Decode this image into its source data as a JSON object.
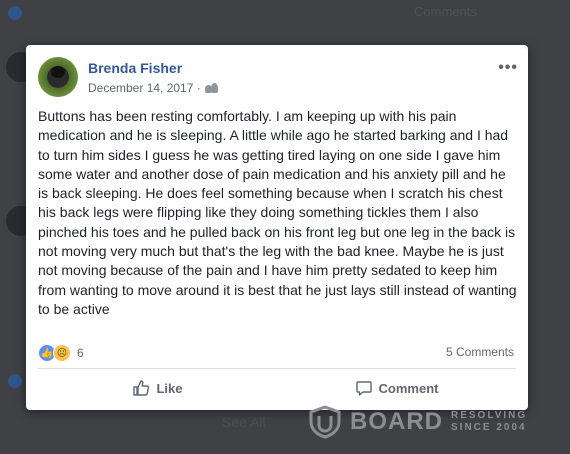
{
  "post": {
    "author": "Brenda Fisher",
    "date": "December 14, 2017 ·",
    "privacy_icon": "friends-icon",
    "more_label": "•••",
    "text": "Buttons has been resting comfortably. I am keeping up with his pain medication and he is sleeping. A little while ago he started barking and I had to turn him sides I guess he was getting tired laying on one side I gave him some water and another dose of pain medication and his anxiety pill and he is back sleeping. He does feel something because when I scratch his chest his back legs were flipping like they doing something tickles them I also pinched his toes and he pulled back on his front leg but one leg in the back is not moving very much but that's the leg with the bad knee. Maybe he is just not moving because of the pain and I have him pretty sedated to keep him from wanting to move around it is best that he just lays still instead of wanting to be active",
    "reactions_count": "6",
    "comments_count": "5 Comments",
    "actions": {
      "like": "Like",
      "comment": "Comment"
    }
  },
  "background": {
    "top_comments": "Comments",
    "see_all": "See All"
  },
  "watermark": {
    "brand": "BOARD",
    "tag_line1": "RESOLVING",
    "tag_line2": "SINCE 2004"
  },
  "colors": {
    "link_blue": "#365899",
    "like_blue": "#5890ff",
    "sad_yellow": "#f7c44a"
  }
}
